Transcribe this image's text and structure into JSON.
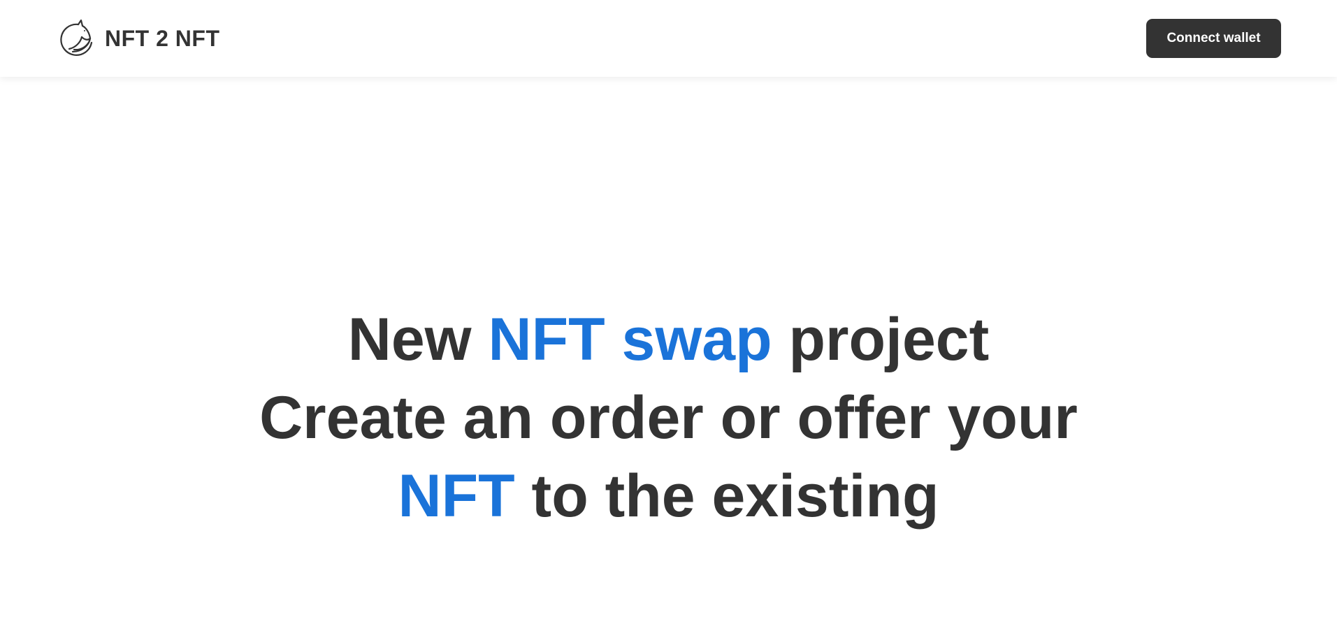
{
  "header": {
    "logo_text": "NFT 2 NFT",
    "logo_icon": "unicorn-icon",
    "connect_label": "Connect wallet"
  },
  "hero": {
    "line1": {
      "before": "New ",
      "accent": "NFT swap",
      "after": " project"
    },
    "line2": {
      "text": "Create an order or offer your"
    },
    "line3": {
      "accent": "NFT",
      "after": " to the existing"
    }
  },
  "colors": {
    "accent": "#1a73d9",
    "text": "#333333",
    "button_bg": "#333333",
    "button_text": "#ffffff",
    "background": "#ffffff"
  }
}
